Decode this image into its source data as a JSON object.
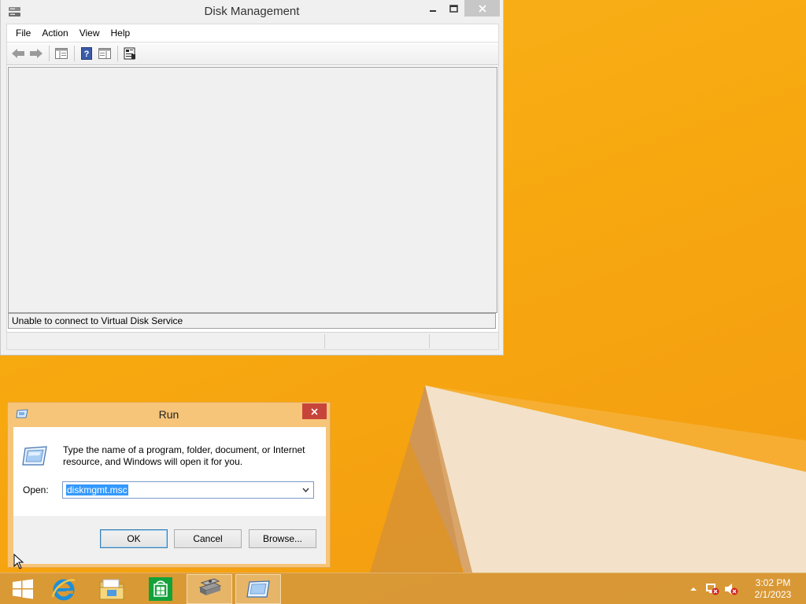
{
  "desktop": {
    "accent": "#f7a80f"
  },
  "disk_management": {
    "title": "Disk Management",
    "menu": [
      "File",
      "Action",
      "View",
      "Help"
    ],
    "status_message": "Unable to connect to Virtual Disk Service",
    "toolbar_icons": [
      "back-arrow-icon",
      "forward-arrow-icon",
      "show-hide-console-tree-icon",
      "help-icon",
      "show-hide-action-pane-icon",
      "properties-icon"
    ]
  },
  "run_dialog": {
    "title": "Run",
    "description": "Type the name of a program, folder, document, or Internet resource, and Windows will open it for you.",
    "open_label": "Open:",
    "open_value": "diskmgmt.msc",
    "buttons": {
      "ok": "OK",
      "cancel": "Cancel",
      "browse": "Browse..."
    }
  },
  "taskbar": {
    "items": [
      "start-button",
      "internet-explorer",
      "file-explorer",
      "store",
      "disk-management",
      "run"
    ],
    "clock": {
      "time": "3:02 PM",
      "date": "2/1/2023"
    }
  }
}
